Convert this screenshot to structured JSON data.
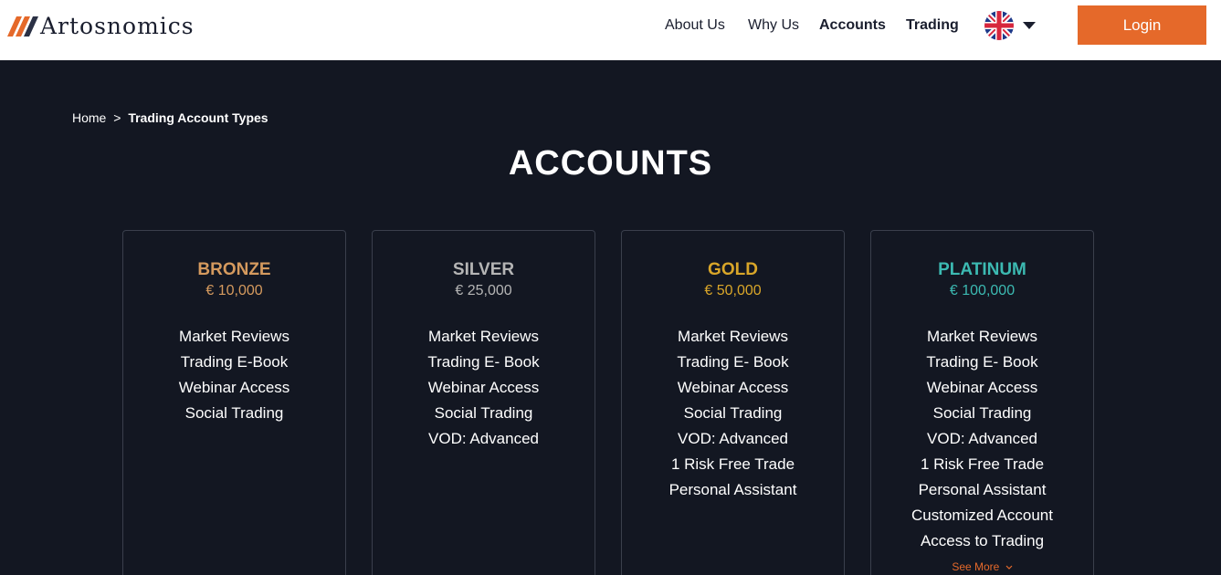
{
  "header": {
    "logo_text": "Artosnomics",
    "nav": [
      {
        "label": "About Us"
      },
      {
        "label": "Why Us"
      },
      {
        "label": "Accounts"
      },
      {
        "label": "Trading"
      }
    ],
    "login_label": "Login"
  },
  "breadcrumb": {
    "home": "Home",
    "separator": ">",
    "current": "Trading Account Types"
  },
  "page_title": "ACCOUNTS",
  "colors": {
    "accent": "#e5692a",
    "bronze": "#d59a5e",
    "silver": "#b5b5b5",
    "gold": "#d9a629",
    "platinum": "#3cbab2",
    "background": "#131722"
  },
  "cards": [
    {
      "name": "BRONZE",
      "price": "€ 10,000",
      "features": [
        "Market Reviews",
        "Trading E-Book",
        "Webinar Access",
        "Social Trading"
      ]
    },
    {
      "name": "SILVER",
      "price": "€ 25,000",
      "features": [
        "Market Reviews",
        "Trading E- Book",
        "Webinar Access",
        "Social Trading",
        "VOD: Advanced"
      ]
    },
    {
      "name": "GOLD",
      "price": "€ 50,000",
      "features": [
        "Market Reviews",
        "Trading E- Book",
        "Webinar Access",
        "Social Trading",
        "VOD: Advanced",
        "1 Risk Free Trade",
        "Personal Assistant"
      ]
    },
    {
      "name": "PLATINUM",
      "price": "€ 100,000",
      "features": [
        "Market Reviews",
        "Trading E- Book",
        "Webinar Access",
        "Social Trading",
        "VOD: Advanced",
        "1 Risk Free Trade",
        "Personal Assistant",
        "Customized Account",
        "Access to Trading"
      ],
      "see_more": "See More"
    }
  ]
}
